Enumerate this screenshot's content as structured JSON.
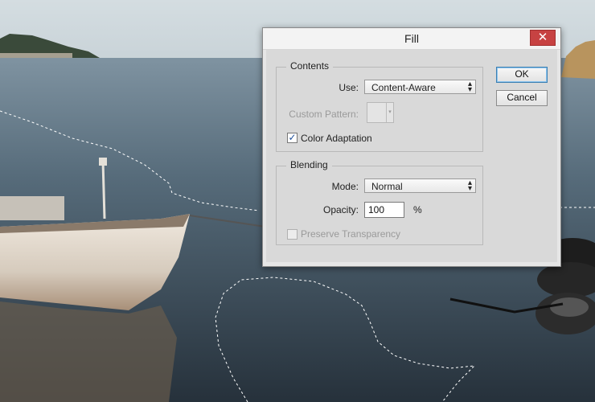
{
  "dialog": {
    "title": "Fill",
    "close_icon": "close-icon",
    "contents": {
      "legend": "Contents",
      "use_label": "Use:",
      "use_value": "Content-Aware",
      "custom_pattern_label": "Custom Pattern:",
      "color_adaptation_label": "Color Adaptation",
      "color_adaptation_checked": true
    },
    "blending": {
      "legend": "Blending",
      "mode_label": "Mode:",
      "mode_value": "Normal",
      "opacity_label": "Opacity:",
      "opacity_value": "100",
      "opacity_unit": "%",
      "preserve_transparency_label": "Preserve Transparency",
      "preserve_transparency_checked": false
    },
    "buttons": {
      "ok": "OK",
      "cancel": "Cancel"
    }
  },
  "colors": {
    "close_button": "#c74242",
    "default_button_border": "#3c7fb1",
    "dialog_background": "#e6e6e6"
  }
}
